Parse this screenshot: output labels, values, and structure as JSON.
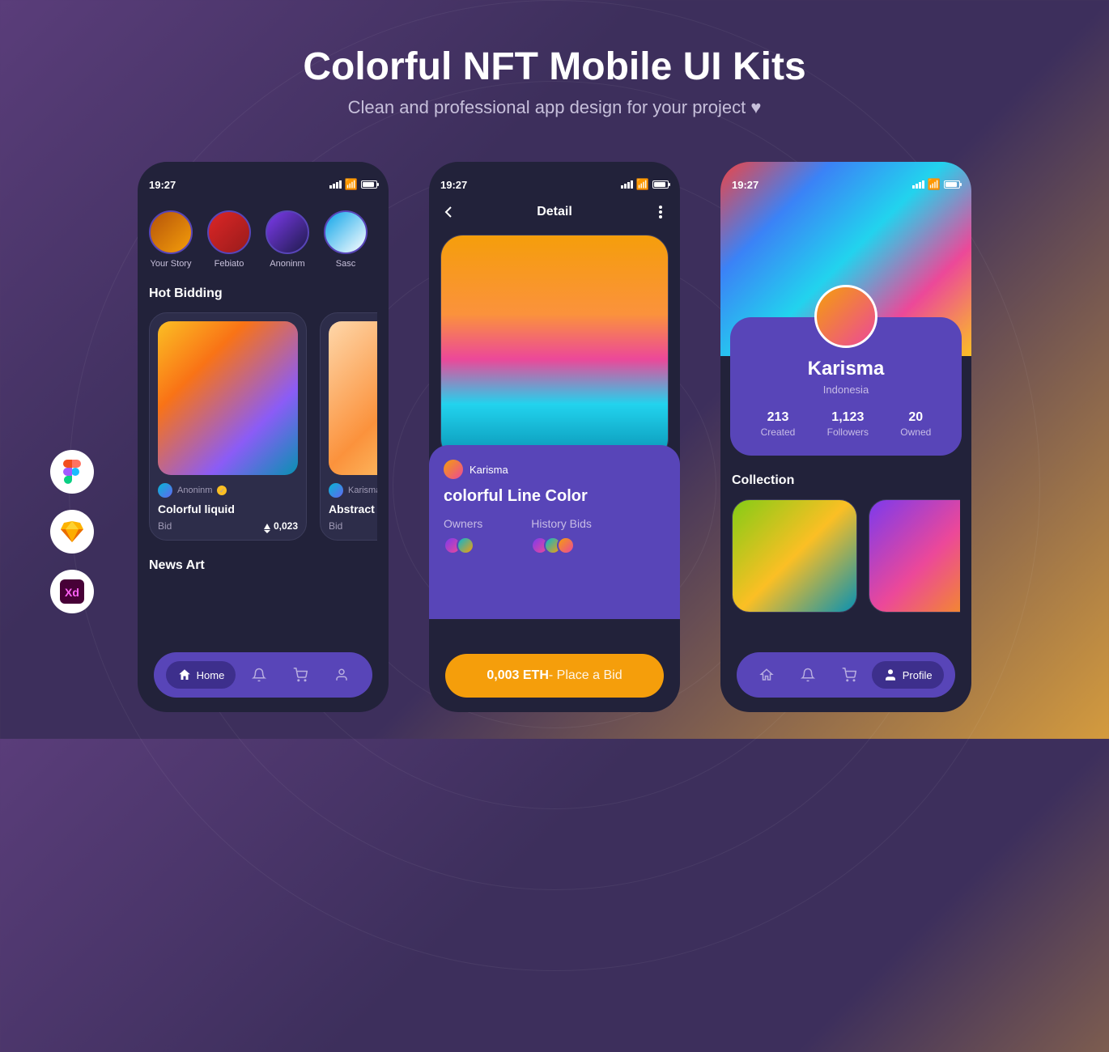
{
  "header": {
    "title": "Colorful NFT Mobile UI Kits",
    "subtitle": "Clean and professional app design for your project ♥"
  },
  "statusbar": {
    "time": "19:27"
  },
  "phone1": {
    "stories": [
      {
        "name": "Your Story"
      },
      {
        "name": "Febiato"
      },
      {
        "name": "Anoninm"
      },
      {
        "name": "Sasc"
      }
    ],
    "hot_bidding_title": "Hot Bidding",
    "cards": [
      {
        "author": "Anoninm",
        "title": "Colorful liquid",
        "bid_label": "Bid",
        "bid_value": "0,023"
      },
      {
        "author": "Karisma",
        "title": "Abstract #",
        "bid_label": "Bid",
        "bid_value": ""
      }
    ],
    "news_title": "News Art",
    "nav": {
      "home": "Home"
    }
  },
  "phone2": {
    "header_title": "Detail",
    "author": "Karisma",
    "title": "colorful Line Color",
    "owners_label": "Owners",
    "history_label": "History Bids",
    "bid_price": "0,003 ETH",
    "bid_action": " - Place a Bid"
  },
  "phone3": {
    "name": "Karisma",
    "location": "Indonesia",
    "stats": {
      "created_n": "213",
      "created_l": "Created",
      "followers_n": "1,123",
      "followers_l": "Followers",
      "owned_n": "20",
      "owned_l": "Owned"
    },
    "collection_title": "Collection",
    "nav": {
      "profile": "Profile"
    }
  },
  "tools": {
    "figma": "Figma",
    "sketch": "Sketch",
    "xd": "Adobe XD"
  }
}
